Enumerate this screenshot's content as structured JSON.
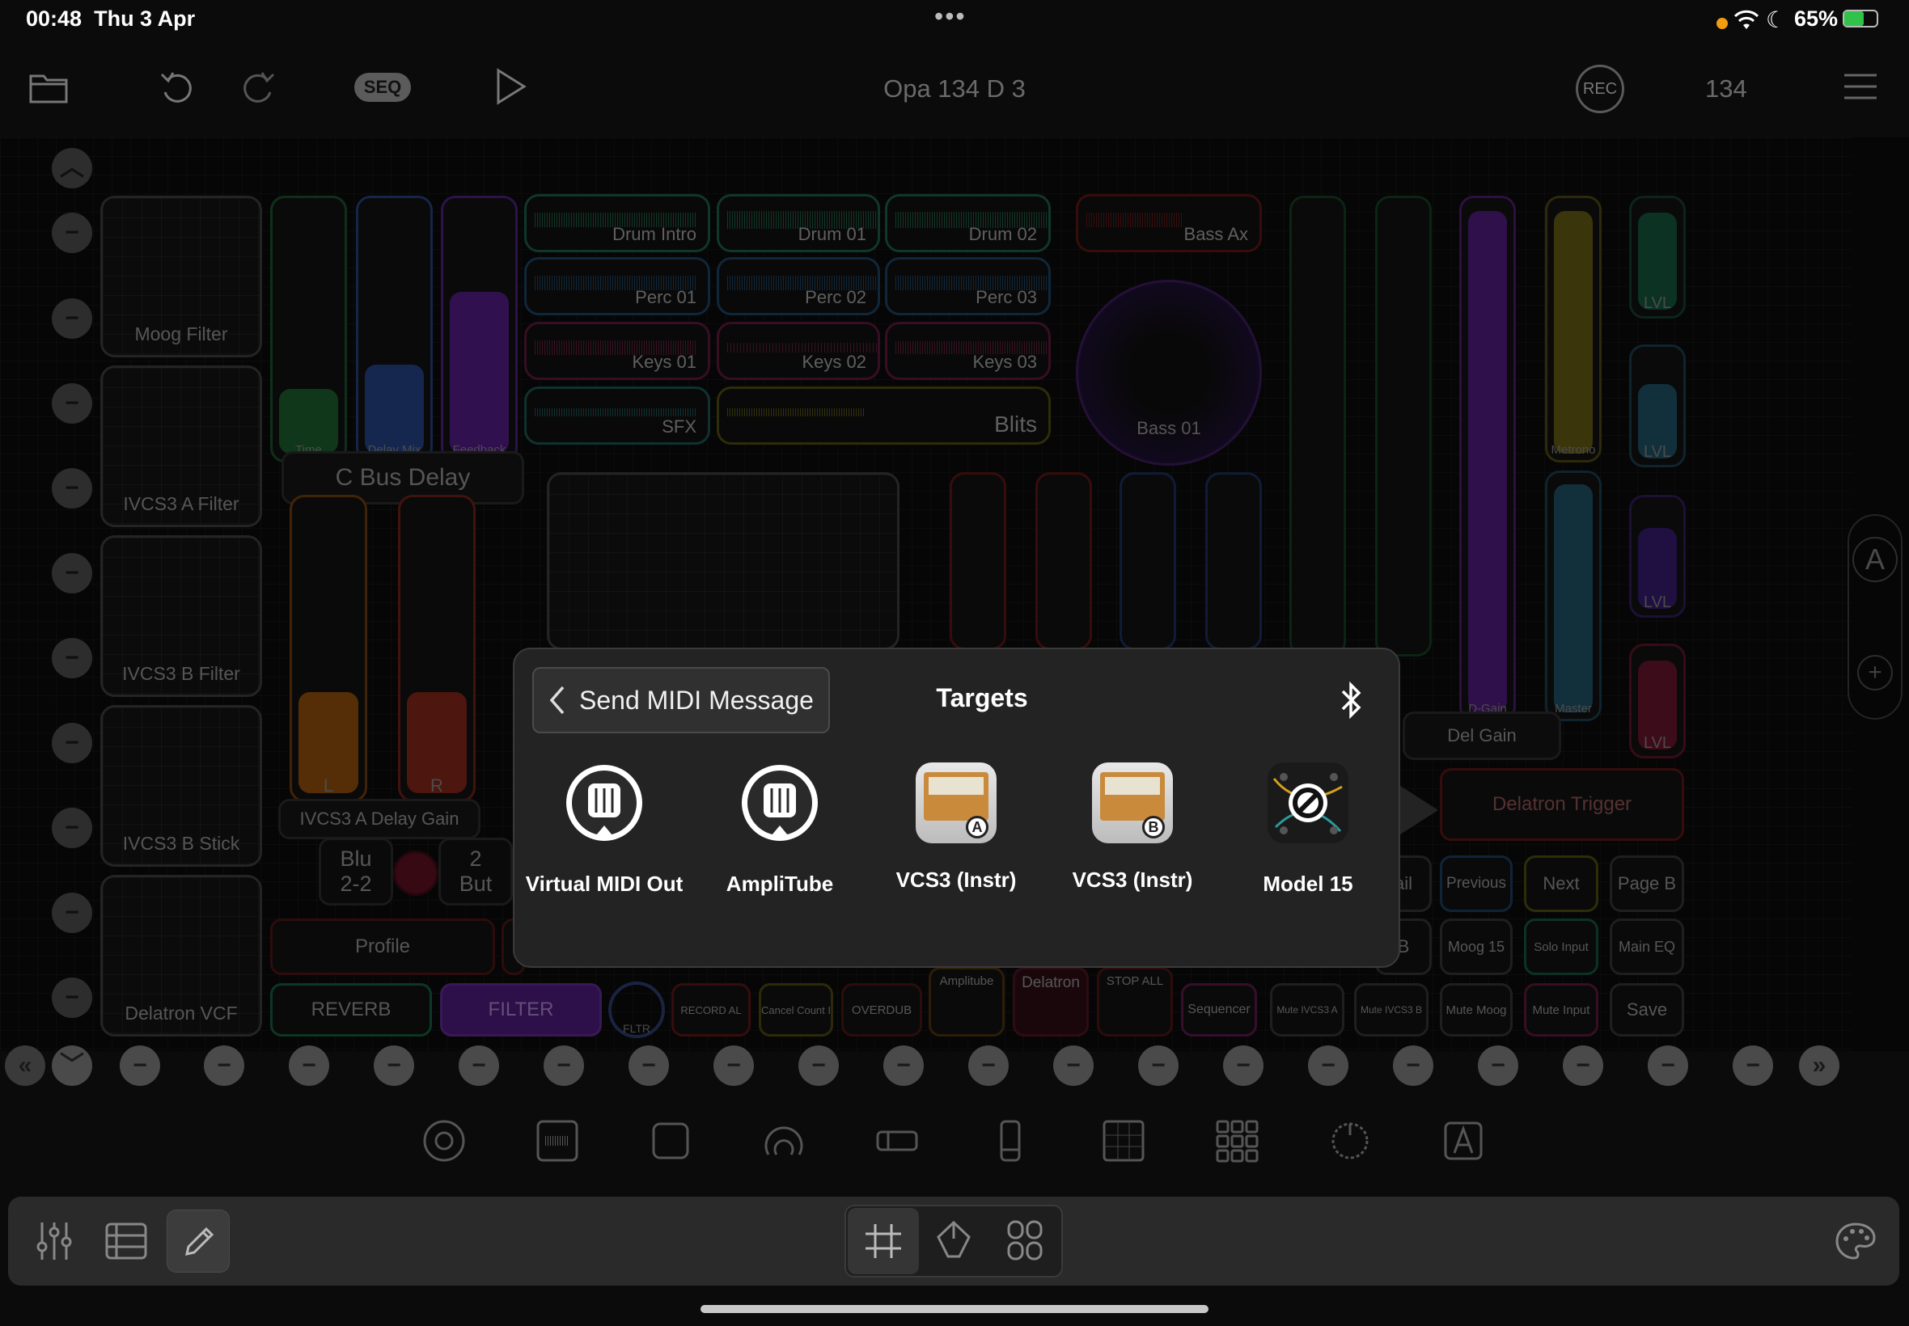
{
  "status_bar": {
    "time": "00:48",
    "date": "Thu 3 Apr",
    "battery": "65%",
    "more": "•••"
  },
  "toolbar": {
    "seq_label": "SEQ",
    "project_title": "Opa 134 D 3",
    "rec_label": "REC",
    "tempo": "134"
  },
  "pads": {
    "moog_filter": "Moog Filter",
    "vcs3a_filter": "IVCS3 A Filter",
    "vcs3b_filter": "IVCS3 B Filter",
    "vcs3b_stick": "IVCS3 B Stick",
    "delatron_vcf": "Delatron VCF"
  },
  "faders": {
    "time": "Time",
    "delay_mix": "Delay Mix",
    "feedback": "Feedback",
    "group_cbus": "C Bus Delay",
    "l": "L",
    "r": "R",
    "group_delay_gain": "IVCS3 A Delay Gain",
    "d_gain": "D-Gain",
    "metronome": "Metrono",
    "master": "Master",
    "del_gain": "Del Gain",
    "lvl": "LVL"
  },
  "samples": {
    "drum_intro": "Drum Intro",
    "drum_01": "Drum 01",
    "drum_02": "Drum 02",
    "bass_ax": "Bass Ax",
    "perc_01": "Perc 01",
    "perc_02": "Perc 02",
    "perc_03": "Perc 03",
    "keys_01": "Keys 01",
    "keys_02": "Keys 02",
    "keys_03": "Keys 03",
    "sfx": "SFX",
    "blits": "Blits",
    "bass_01": "Bass 01"
  },
  "buttons": {
    "blu": "Blu\n2-2",
    "two_but": "2\nBut",
    "profile": "Profile",
    "reverb": "REVERB",
    "filter": "FILTER",
    "fltr": "FLTR",
    "record_al": "RECORD AL",
    "cancel_count": "Cancel Count I",
    "overdub": "OVERDUB",
    "amplitube": "Amplitube",
    "delatron": "Delatron",
    "stop_all": "STOP ALL",
    "sequencer": "Sequencer",
    "mute_vcs3a": "Mute IVCS3 A",
    "mute_vcs3b": "Mute IVCS3 B",
    "mute_moog": "Mute Moog",
    "mute_input": "Mute Input",
    "save": "Save",
    "ail": "ail",
    "b": "B",
    "moog15": "Moog 15",
    "solo_input": "Solo Input",
    "main_eq": "Main EQ",
    "previous": "Previous",
    "next": "Next",
    "page_b": "Page B",
    "delatron_trigger": "Delatron Trigger",
    "side_a": "A"
  },
  "popover": {
    "back_label": "Send MIDI Message",
    "title": "Targets",
    "targets": [
      {
        "label": "Virtual MIDI Out",
        "icon": "midi-port-icon"
      },
      {
        "label": "AmpliTube",
        "icon": "midi-port-icon"
      },
      {
        "label": "VCS3 (Instr)",
        "icon": "vcs3-synth-a-icon",
        "badge": "A"
      },
      {
        "label": "VCS3 (Instr)",
        "icon": "vcs3-synth-b-icon",
        "badge": "B"
      },
      {
        "label": "Model 15",
        "icon": "model15-modular-icon"
      }
    ]
  },
  "colors": {
    "green": "#1f8f5a",
    "blue": "#2a5ea8",
    "purple": "#7a2fc0",
    "orange": "#c46a12",
    "red": "#b0281f",
    "yellow": "#a49a12",
    "pink": "#a8235a",
    "teal": "#1b8a8a"
  }
}
